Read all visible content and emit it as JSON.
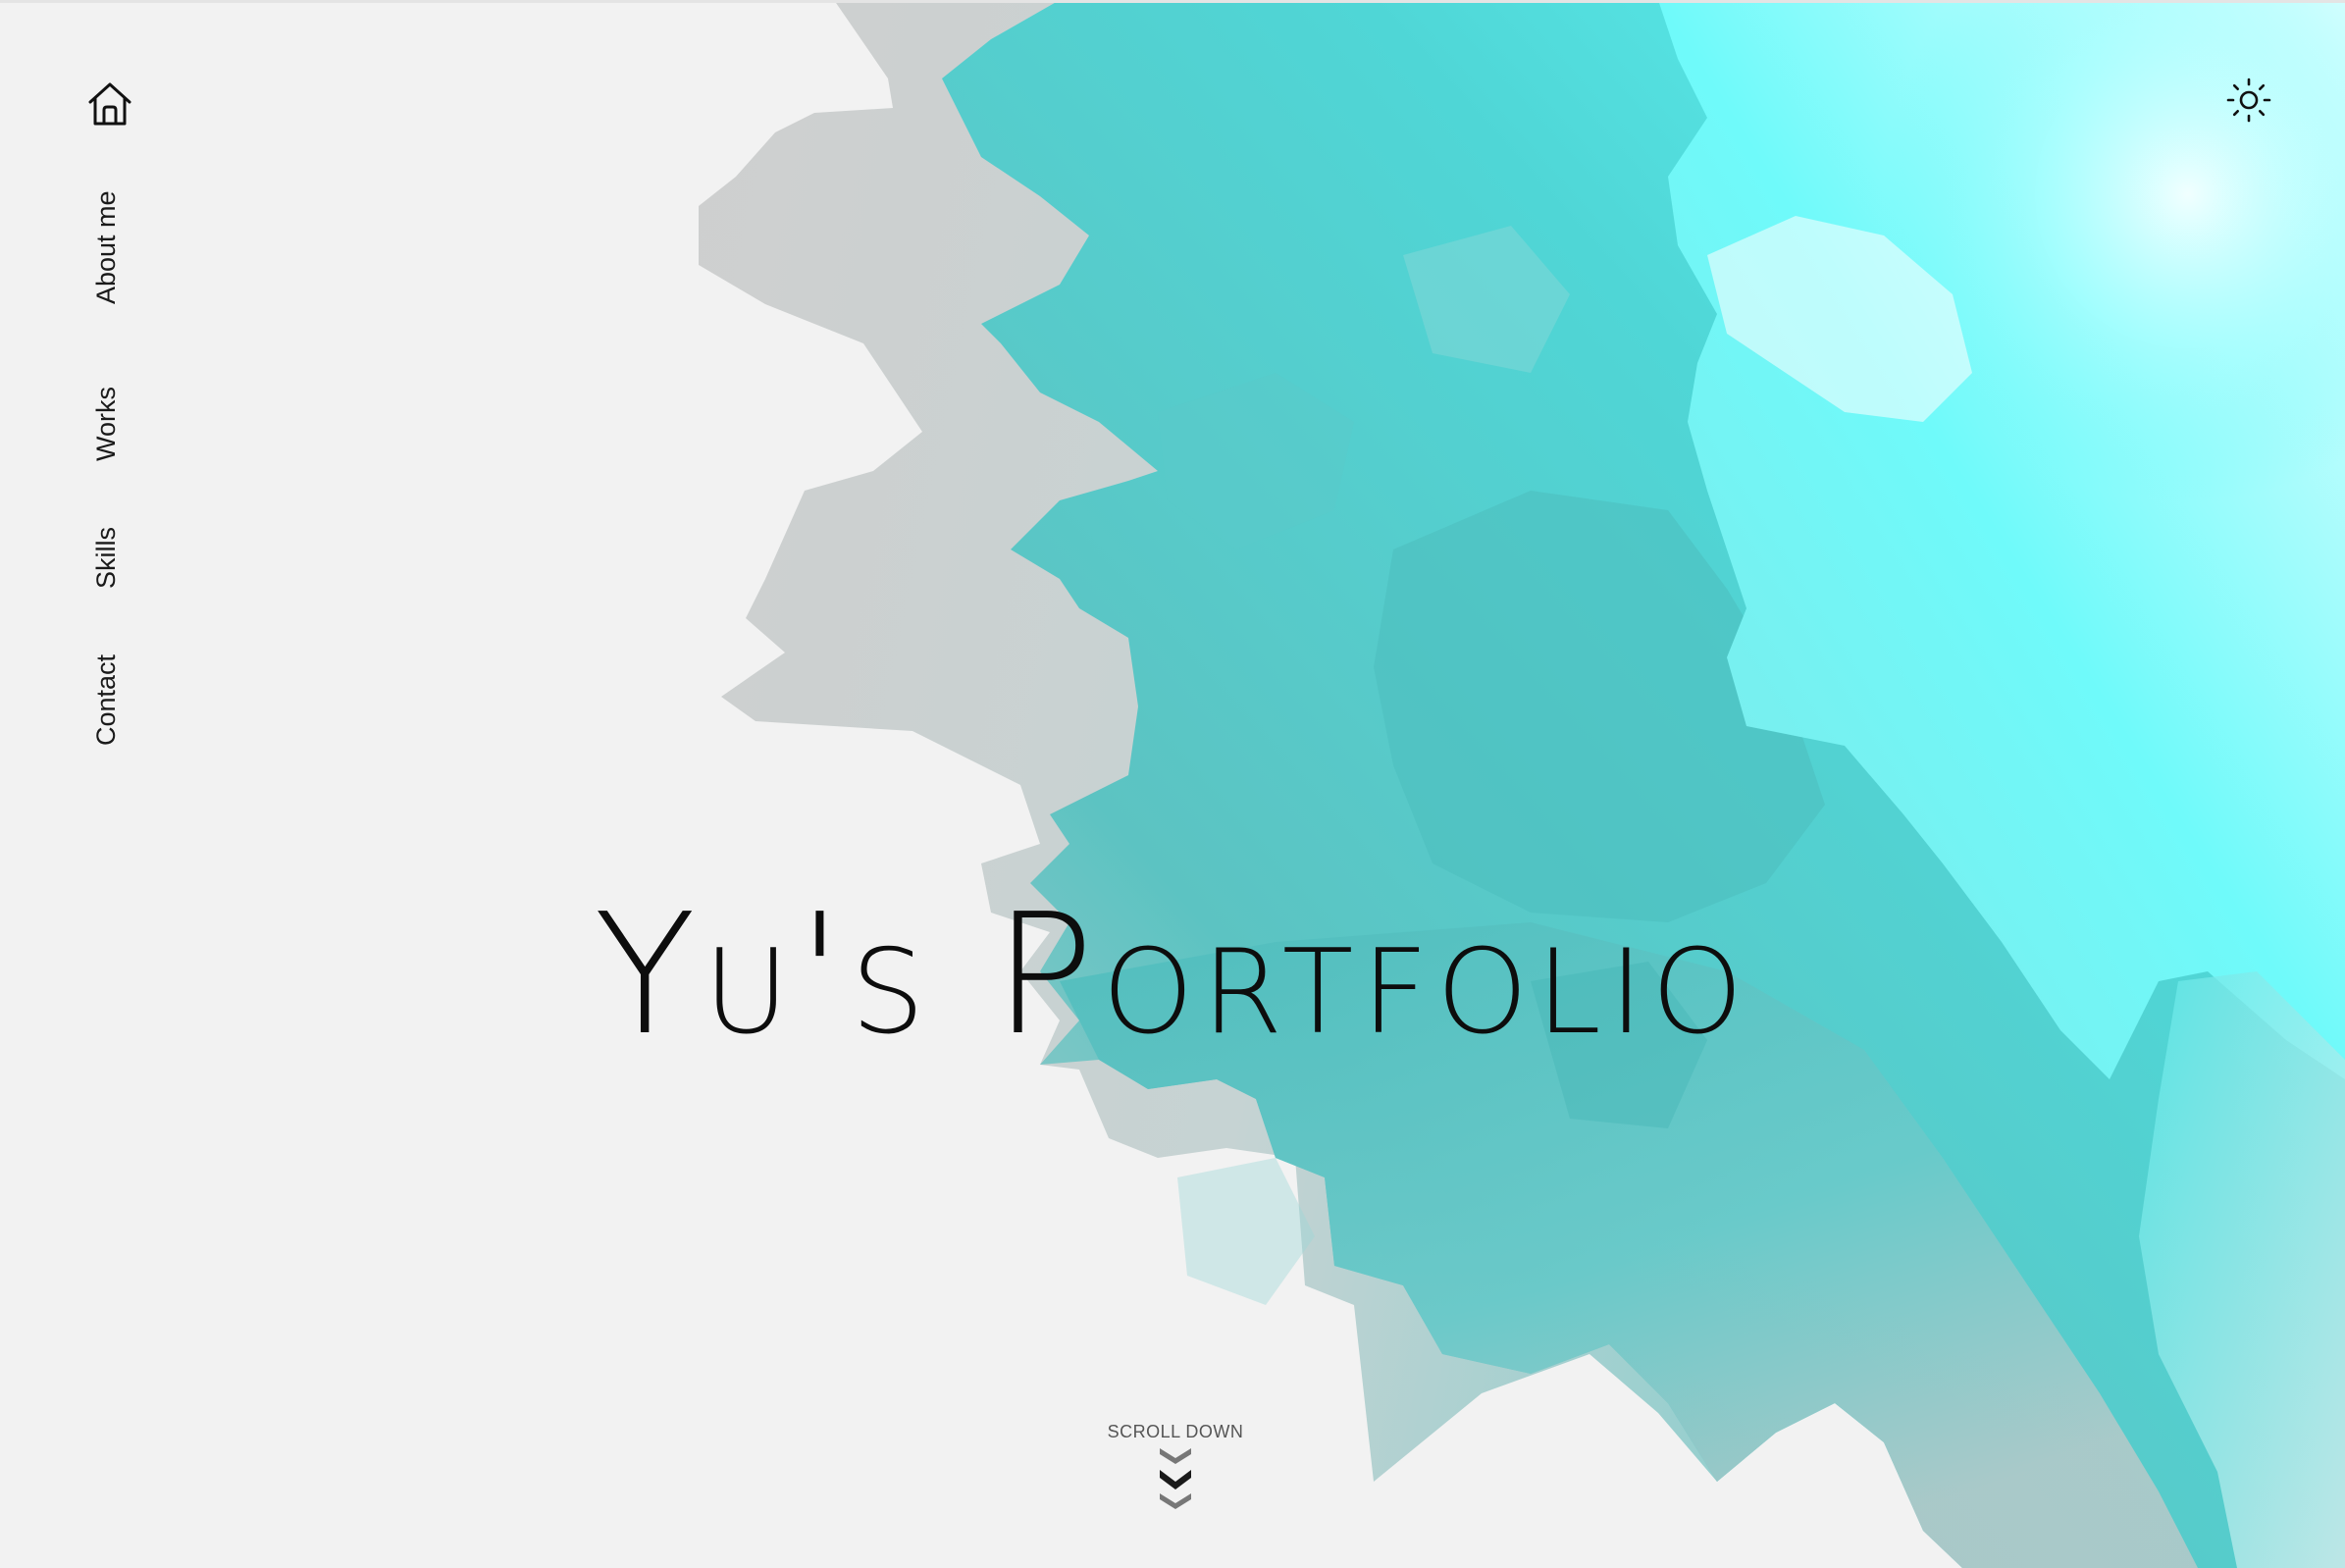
{
  "page": {
    "title": "Yu's Portfolio",
    "background_color": "#f2f2f2",
    "accent_color": "#4fd6d6"
  },
  "header": {
    "home_icon": "home-icon",
    "theme_icon": "sun-icon"
  },
  "nav": {
    "items": [
      {
        "label": "About me"
      },
      {
        "label": "Works"
      },
      {
        "label": "Skills"
      },
      {
        "label": "Contact"
      }
    ]
  },
  "hero": {
    "title": "Yu's Portfolio"
  },
  "scroll": {
    "label": "SCROLL DOWN",
    "icon": "chevrons-down-icon"
  }
}
